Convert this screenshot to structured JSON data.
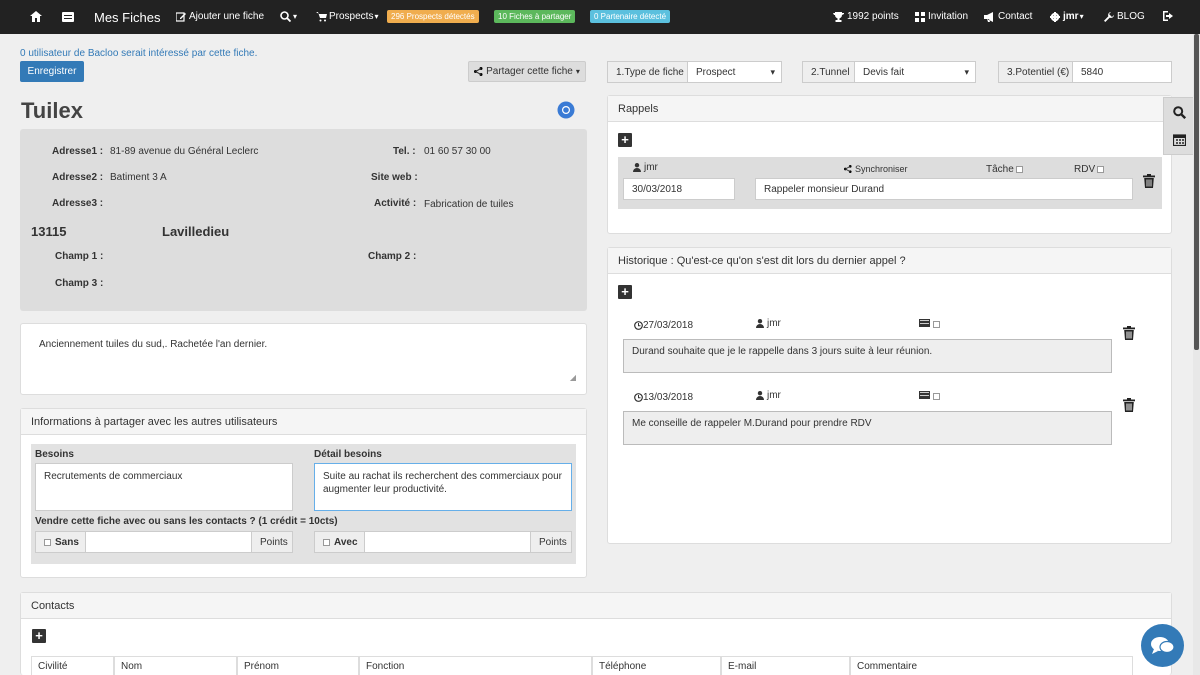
{
  "nav": {
    "brand": "Mes Fiches",
    "add": "Ajouter une fiche",
    "prospects": "Prospects",
    "badge1": "296 Prospects détectés",
    "badge2": "10 Fiches à partager",
    "badge3": "0 Partenaire détecté",
    "points": "1992 points",
    "invitation": "Invitation",
    "contact": "Contact",
    "user": "jmr",
    "blog": "BLOG"
  },
  "notice": "0 utilisateur de Bacloo serait intéressé par cette fiche.",
  "save": "Enregistrer",
  "share": "Partager cette fiche",
  "fields": {
    "type_label": "1.Type de fiche",
    "type_value": "Prospect",
    "tunnel_label": "2.Tunnel",
    "tunnel_value": "Devis fait",
    "pot_label": "3.Potentiel (€)",
    "pot_value": "5840"
  },
  "company": {
    "name": "Tuilex",
    "adr1_l": "Adresse1 :",
    "adr1": "81-89 avenue du Général Leclerc",
    "adr2_l": "Adresse2 :",
    "adr2": "Batiment 3 A",
    "adr3_l": "Adresse3 :",
    "tel_l": "Tel. :",
    "tel": "01 60 57 30 00",
    "web_l": "Site web :",
    "act_l": "Activité :",
    "act": "Fabrication de tuiles",
    "cp": "13115",
    "city": "Lavilledieu",
    "c1_l": "Champ 1 :",
    "c2_l": "Champ 2 :",
    "c3_l": "Champ 3 :"
  },
  "notes": "Anciennement tuiles du sud,. Rachetée l'an dernier.",
  "share_panel": {
    "title": "Informations à partager avec les autres utilisateurs",
    "besoins_l": "Besoins",
    "besoins": "Recrutements de commerciaux",
    "detail_l": "Détail besoins",
    "detail": "Suite au rachat ils recherchent des commerciaux pour augmenter leur productivité.",
    "sell": "Vendre cette fiche avec ou sans les contacts ? (1 crédit = 10cts)",
    "sans": "Sans",
    "avec": "Avec",
    "points": "Points"
  },
  "rappels": {
    "title": "Rappels",
    "user": "jmr",
    "sync": "Synchroniser",
    "tache": "Tâche",
    "rdv": "RDV",
    "date": "30/03/2018",
    "text": "Rappeler monsieur Durand"
  },
  "historique": {
    "title": "Historique : Qu'est-ce qu'on s'est dit lors du dernier appel ?",
    "items": [
      {
        "date": "27/03/2018",
        "user": "jmr",
        "text": "Durand souhaite que je le rappelle dans 3 jours suite à leur réunion."
      },
      {
        "date": "13/03/2018",
        "user": "jmr",
        "text": "Me conseille de rappeler M.Durand pour prendre RDV"
      }
    ]
  },
  "contacts": {
    "title": "Contacts",
    "cols": [
      "Civilité",
      "Nom",
      "Prénom",
      "Fonction",
      "Téléphone",
      "E-mail",
      "Commentaire"
    ]
  }
}
